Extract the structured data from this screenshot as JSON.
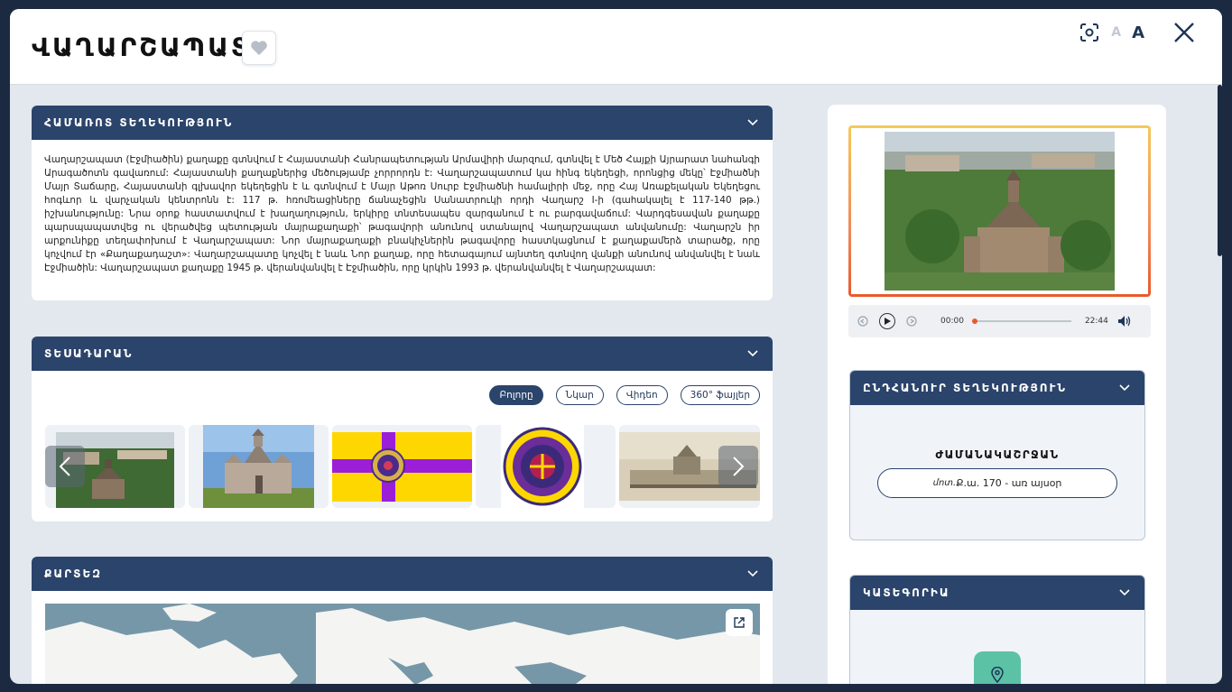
{
  "header": {
    "title": "ՎԱՂԱՐՇԱՊԱՏ",
    "font_small_label": "A",
    "font_big_label": "A"
  },
  "general_info": {
    "heading": "ՀԱՄԱՌՈՏ ՏԵՂԵԿՈՒԹՅՈՒՆ",
    "text": "Վաղարշապատ (Էջմիածին) քաղաքը գտնվում է Հայաստանի Հանրապետության Արմավիրի մարզում, գտնվել է Մեծ Հայքի Այրարատ նահանգի Արագածոտն գավառում: Հայաստանի քաղաքներից մեծությամբ չորրորդն է: Վաղարշապատում կա հինգ եկեղեցի, որոնցից մեկը՝ Էջմիածնի Մայր Տաճարը, Հայաստանի գլխավոր եկեղեցին է և գտնվում է Մայր Աթոռ Սուրբ Էջմիածնի համալիրի մեջ, որը Հայ Առաքելական Եկեղեցու հոգևոր և վարչական կենտրոնն է: 117 թ. հռոմեացիները ճանաչեցին Սանատրուկի որդի Վաղարշ I-ի (գահակալել է 117-140 թթ.) իշխանությունը: Նրա օրոք հաստատվում է խաղաղություն, երկիրը տնտեսապես զարգանում է ու բարգավաճում: Վարդգեսավան քաղաքը պարսպապատվեց ու վերածվեց պետության մայրաքաղաքի՝ թագավորի անունով ստանալով Վաղարշապատ անվանումը: Վաղարշն իր արքունիքը տեղափոխում է Վաղարշապատ: Նոր մայրաքաղաքի բնակիչներին թագավորը հաստկացնում է քաղաքամերձ տարածք, որը կոչվում էր «Քաղաքադաշտ»: Վաղարշապատը կոչվել է նաև Նոր քաղաք, որը հետագայում այնտեղ գտնվող վանքի անունով անվանվել է նաև Էջմիածին: Վաղարշապատ քաղաքը 1945 թ. վերանվանվել է Էջմիածին, որը կրկին 1993 թ. վերանվանվել է Վաղարշապատ:"
  },
  "gallery": {
    "heading": "ՏԵՍԱԴԱՐԱՆ",
    "filters": [
      "Բոլորը",
      "Նկար",
      "Վիդեո",
      "360° ֆայլեր"
    ]
  },
  "map": {
    "heading": "ՔԱՐՏԵԶ"
  },
  "audio": {
    "current_time": "00:00",
    "duration": "22:44",
    "progress": 0
  },
  "timeline": {
    "heading": "ԸՆԴՀԱՆՈՒՐ ՏԵՂԵԿՈՒԹՅՈՒՆ",
    "label": "ԺԱՄԱՆԱԿԱՇՐՋԱՆ",
    "value_italic": "մոտ.",
    "value": "Ք.ա. 170 - առ այսօր"
  },
  "category": {
    "heading": "ԿԱՏԵԳՈՐԻԱ"
  },
  "colors": {
    "panel_header": "#2b446b",
    "accent_gradient_top": "#f4c95a",
    "accent_gradient_bottom": "#e85a2e",
    "category_icon_bg": "#5bc2a5"
  }
}
